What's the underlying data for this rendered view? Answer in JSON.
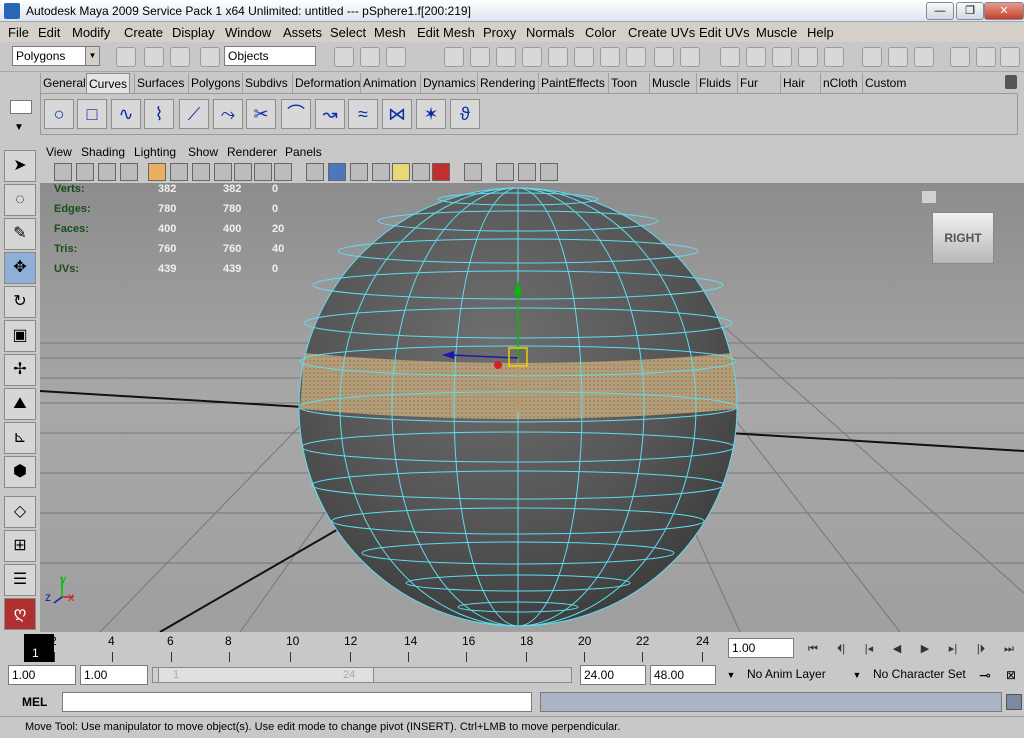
{
  "window": {
    "title": "Autodesk Maya 2009 Service Pack 1 x64 Unlimited: untitled   ---   pSphere1.f[200:219]",
    "min": "—",
    "max": "❐",
    "close": "✕"
  },
  "menubar": [
    "File",
    "Edit",
    "Modify",
    "Create",
    "Display",
    "Window",
    "Assets",
    "Select",
    "Mesh",
    "Edit Mesh",
    "Proxy",
    "Normals",
    "Color",
    "Create UVs",
    "Edit UVs",
    "Muscle",
    "Help"
  ],
  "statusline": {
    "menu_set": "Polygons",
    "selection_field": "Objects"
  },
  "shelf_tabs": [
    "General",
    "Curves",
    "Surfaces",
    "Polygons",
    "Subdivs",
    "Deformation",
    "Animation",
    "Dynamics",
    "Rendering",
    "PaintEffects",
    "Toon",
    "Muscle",
    "Fluids",
    "Fur",
    "Hair",
    "nCloth",
    "Custom"
  ],
  "shelf_active": "Curves",
  "panel_menu": [
    "View",
    "Shading",
    "Lighting",
    "Show",
    "Renderer",
    "Panels"
  ],
  "hud": [
    {
      "label": "Verts:",
      "a": "382",
      "b": "382",
      "c": "0"
    },
    {
      "label": "Edges:",
      "a": "780",
      "b": "780",
      "c": "0"
    },
    {
      "label": "Faces:",
      "a": "400",
      "b": "400",
      "c": "20"
    },
    {
      "label": "Tris:",
      "a": "760",
      "b": "760",
      "c": "40"
    },
    {
      "label": "UVs:",
      "a": "439",
      "b": "439",
      "c": "0"
    }
  ],
  "viewcube_label": "RIGHT",
  "axis_labels": {
    "y": "y",
    "z": "z",
    "x": "x"
  },
  "timeslider": {
    "current_frame": "1",
    "ticks": [
      "2",
      "4",
      "6",
      "8",
      "10",
      "12",
      "14",
      "16",
      "18",
      "20",
      "22",
      "24"
    ],
    "current_time_field": "1.00"
  },
  "range": {
    "start_time": "1.00",
    "playback_start": "1.00",
    "handle_start": "1",
    "handle_end": "24",
    "playback_end": "24.00",
    "end_time": "48.00",
    "anim_layer": "No Anim Layer",
    "character_set": "No Character Set"
  },
  "commandline": {
    "label": "MEL"
  },
  "helpline": "Move Tool: Use manipulator to move object(s). Use edit mode to change pivot (INSERT).  Ctrl+LMB to move perpendicular.",
  "colors": {
    "wire": "#5fdcf0",
    "selected_faces": "#b8a07a",
    "viewport_top": "#8c8c8c",
    "viewport_bottom": "#a8a8a8"
  }
}
